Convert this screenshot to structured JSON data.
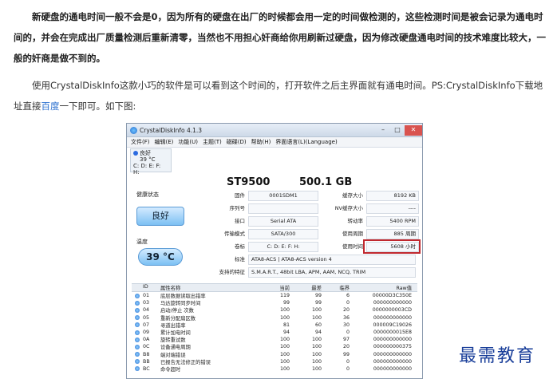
{
  "article": {
    "para1": "新硬盘的通电时间一般不会是0，因为所有的硬盘在出厂的时候都会用一定的时间做检测的，这些检测时间是被会记录为通电时间的，并会在完成出厂质量检测后重新清零，当然也不用担心奸商给你用刷新过硬盘，因为修改硬盘通电时间的技术难度比较大，一般的奸商是做不到的。",
    "para2_part1": "使用CrystalDiskInfo这款小巧的软件是可以看到这个时间的，打开软件之后主界面就有通电时间。PS:CrystalDiskInfo下载地址直接",
    "para2_link": "百度",
    "para2_part2": "一下即可。如下图:"
  },
  "window": {
    "title": "CrystalDiskInfo 4.1.3",
    "menu": [
      "文件(F)",
      "编辑(E)",
      "功能(U)",
      "主题(T)",
      "磁碟(D)",
      "帮助(H)",
      "界面语言(L)(Language)"
    ],
    "drive_tab": {
      "status": "良好",
      "temp": "39 °C",
      "letters": "C: D: E: F: H:"
    },
    "model": "ST9500",
    "capacity": "500.1 GB",
    "health_label": "健康状态",
    "health_value": "良好",
    "temp_label": "温度",
    "temp_value": "39 °C",
    "left_fields": [
      {
        "key": "固件",
        "value": "0001SDM1"
      },
      {
        "key": "序列号",
        "value": ""
      },
      {
        "key": "接口",
        "value": "Serial ATA"
      },
      {
        "key": "传输模式",
        "value": "SATA/300"
      },
      {
        "key": "卷标",
        "value": "C: D: E: F: H:"
      },
      {
        "key": "标准",
        "value": "ATA8-ACS | ATA8-ACS version 4"
      }
    ],
    "right_fields": [
      {
        "key": "缓存大小",
        "value": "8192 KB"
      },
      {
        "key": "NV缓存大小",
        "value": "----"
      },
      {
        "key": "转动率",
        "value": "5400 RPM"
      },
      {
        "key": "使用周期",
        "value": "885 周期"
      },
      {
        "key": "使用时间",
        "value": "5608 小时"
      }
    ],
    "features_key": "支持的特征",
    "features_value": "S.M.A.R.T., 48bit LBA, APM, AAM, NCQ, TRIM",
    "table_headers": [
      "ID",
      "属性名称",
      "当前",
      "最差",
      "临界",
      "Raw值"
    ],
    "table_rows": [
      {
        "id": "01",
        "name": "底层数据读取出错率",
        "cur": "119",
        "worst": "99",
        "thr": "6",
        "raw": "00000D3C350E"
      },
      {
        "id": "03",
        "name": "马达旋转同步时间",
        "cur": "99",
        "worst": "99",
        "thr": "0",
        "raw": "000000000000"
      },
      {
        "id": "04",
        "name": "启动/停止 次数",
        "cur": "100",
        "worst": "100",
        "thr": "20",
        "raw": "0000000003CD"
      },
      {
        "id": "05",
        "name": "重新分配扇区数",
        "cur": "100",
        "worst": "100",
        "thr": "36",
        "raw": "000000000000"
      },
      {
        "id": "07",
        "name": "寻道出错率",
        "cur": "81",
        "worst": "60",
        "thr": "30",
        "raw": "000009C19026"
      },
      {
        "id": "09",
        "name": "累计加电时间",
        "cur": "94",
        "worst": "94",
        "thr": "0",
        "raw": "0000000015E8"
      },
      {
        "id": "0A",
        "name": "旋转重试数",
        "cur": "100",
        "worst": "100",
        "thr": "97",
        "raw": "000000000000"
      },
      {
        "id": "0C",
        "name": "设备通电周期",
        "cur": "100",
        "worst": "100",
        "thr": "20",
        "raw": "000000000375"
      },
      {
        "id": "B8",
        "name": "端对端错误",
        "cur": "100",
        "worst": "100",
        "thr": "99",
        "raw": "000000000000"
      },
      {
        "id": "BB",
        "name": "已报告无法修正的错误",
        "cur": "100",
        "worst": "100",
        "thr": "0",
        "raw": "000000000000"
      },
      {
        "id": "BC",
        "name": "命令超时",
        "cur": "100",
        "worst": "100",
        "thr": "0",
        "raw": "000000000000"
      }
    ]
  },
  "watermark": "最需教育"
}
